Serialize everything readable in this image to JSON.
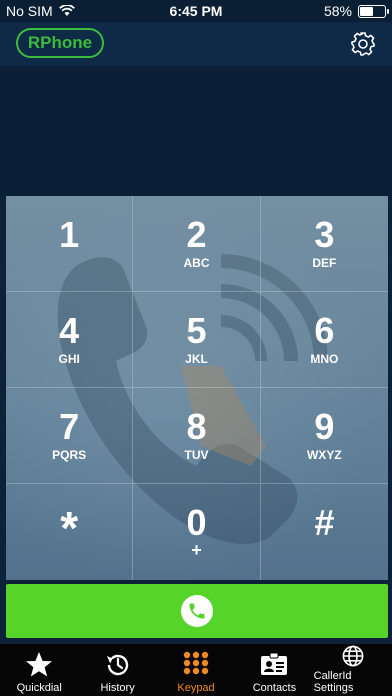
{
  "status_bar": {
    "carrier": "No SIM",
    "time": "6:45 PM",
    "battery": "58%",
    "battery_level": 0.58
  },
  "header": {
    "logo": "RPhone",
    "settings_icon": "gear-icon"
  },
  "keypad": {
    "keys": [
      {
        "digit": "1",
        "letters": ""
      },
      {
        "digit": "2",
        "letters": "ABC"
      },
      {
        "digit": "3",
        "letters": "DEF"
      },
      {
        "digit": "4",
        "letters": "GHI"
      },
      {
        "digit": "5",
        "letters": "JKL"
      },
      {
        "digit": "6",
        "letters": "MNO"
      },
      {
        "digit": "7",
        "letters": "PQRS"
      },
      {
        "digit": "8",
        "letters": "TUV"
      },
      {
        "digit": "9",
        "letters": "WXYZ"
      },
      {
        "digit": "*",
        "letters": ""
      },
      {
        "digit": "0",
        "letters": "+"
      },
      {
        "digit": "#",
        "letters": ""
      }
    ]
  },
  "call_button": {
    "icon": "phone-icon"
  },
  "tabs": [
    {
      "label": "Quickdial",
      "icon": "star-icon"
    },
    {
      "label": "History",
      "icon": "history-icon"
    },
    {
      "label": "Keypad",
      "icon": "keypad-icon",
      "active": true
    },
    {
      "label": "Contacts",
      "icon": "contacts-icon"
    },
    {
      "label": "CallerId Settings",
      "icon": "globe-icon"
    }
  ],
  "colors": {
    "accent_green": "#56d42a",
    "logo_green": "#3dbb3a",
    "active_tab": "#f08a24"
  }
}
